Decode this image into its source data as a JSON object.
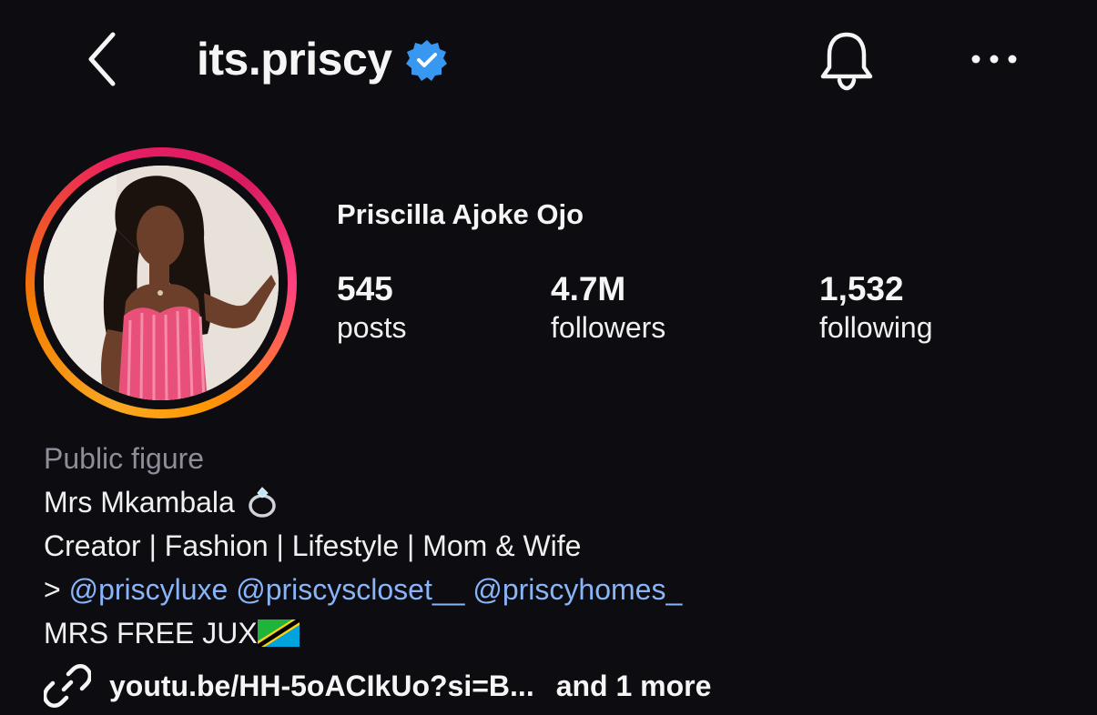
{
  "header": {
    "back_icon": "chevron-left-icon",
    "username": "its.priscy",
    "verified_icon": "verified-badge-icon",
    "notifications_icon": "bell-icon",
    "more_icon": "more-horizontal-icon",
    "verified_color": "#3897f0"
  },
  "profile": {
    "display_name": "Priscilla Ajoke Ojo",
    "stats": [
      {
        "value": "545",
        "label": "posts"
      },
      {
        "value": "4.7M",
        "label": "followers"
      },
      {
        "value": "1,532",
        "label": "following"
      }
    ]
  },
  "bio": {
    "category": "Public figure",
    "line1": "Mrs Mkambala",
    "line2": "Creator | Fashion | Lifestyle | Mom & Wife",
    "line3_prefix": ">",
    "mentions": [
      "@priscyluxe",
      "@priscyscloset__",
      "@priscyhomes_"
    ],
    "line4": "MRS FREE JUX",
    "ring_icon": "ring-icon",
    "flag_icon": "tanzania-flag-icon"
  },
  "link": {
    "icon": "link-icon",
    "url_text": "youtu.be/HH-5oACIkUo?si=B...",
    "more_text": "and 1 more"
  },
  "colors": {
    "background": "#0c0c11",
    "mention": "#8ab4f8",
    "category": "#8e8e99"
  }
}
